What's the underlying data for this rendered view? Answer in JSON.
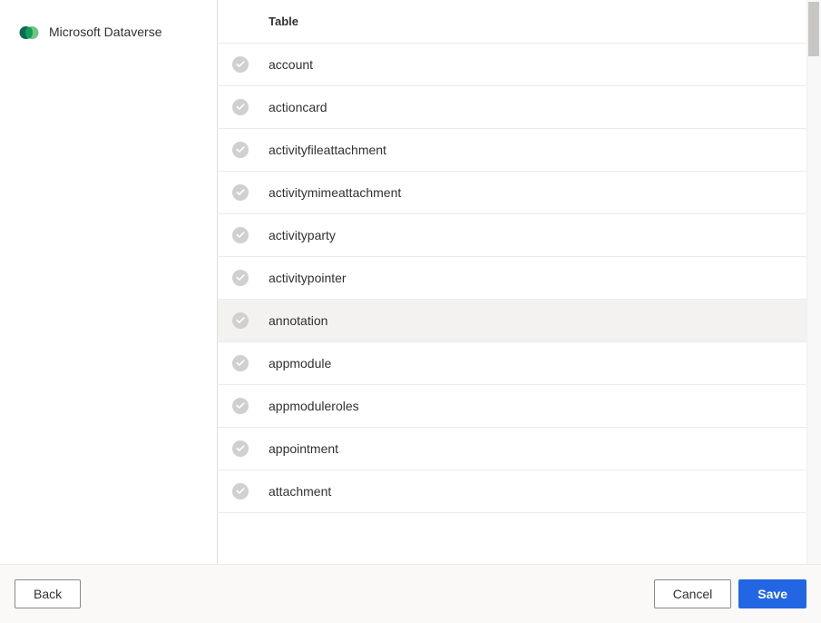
{
  "sidebar": {
    "source_label": "Microsoft Dataverse"
  },
  "table": {
    "header_label": "Table",
    "rows": [
      {
        "name": "account",
        "selected": false
      },
      {
        "name": "actioncard",
        "selected": false
      },
      {
        "name": "activityfileattachment",
        "selected": false
      },
      {
        "name": "activitymimeattachment",
        "selected": false
      },
      {
        "name": "activityparty",
        "selected": false
      },
      {
        "name": "activitypointer",
        "selected": false
      },
      {
        "name": "annotation",
        "selected": true
      },
      {
        "name": "appmodule",
        "selected": false
      },
      {
        "name": "appmoduleroles",
        "selected": false
      },
      {
        "name": "appointment",
        "selected": false
      },
      {
        "name": "attachment",
        "selected": false
      }
    ]
  },
  "footer": {
    "back_label": "Back",
    "cancel_label": "Cancel",
    "save_label": "Save"
  }
}
